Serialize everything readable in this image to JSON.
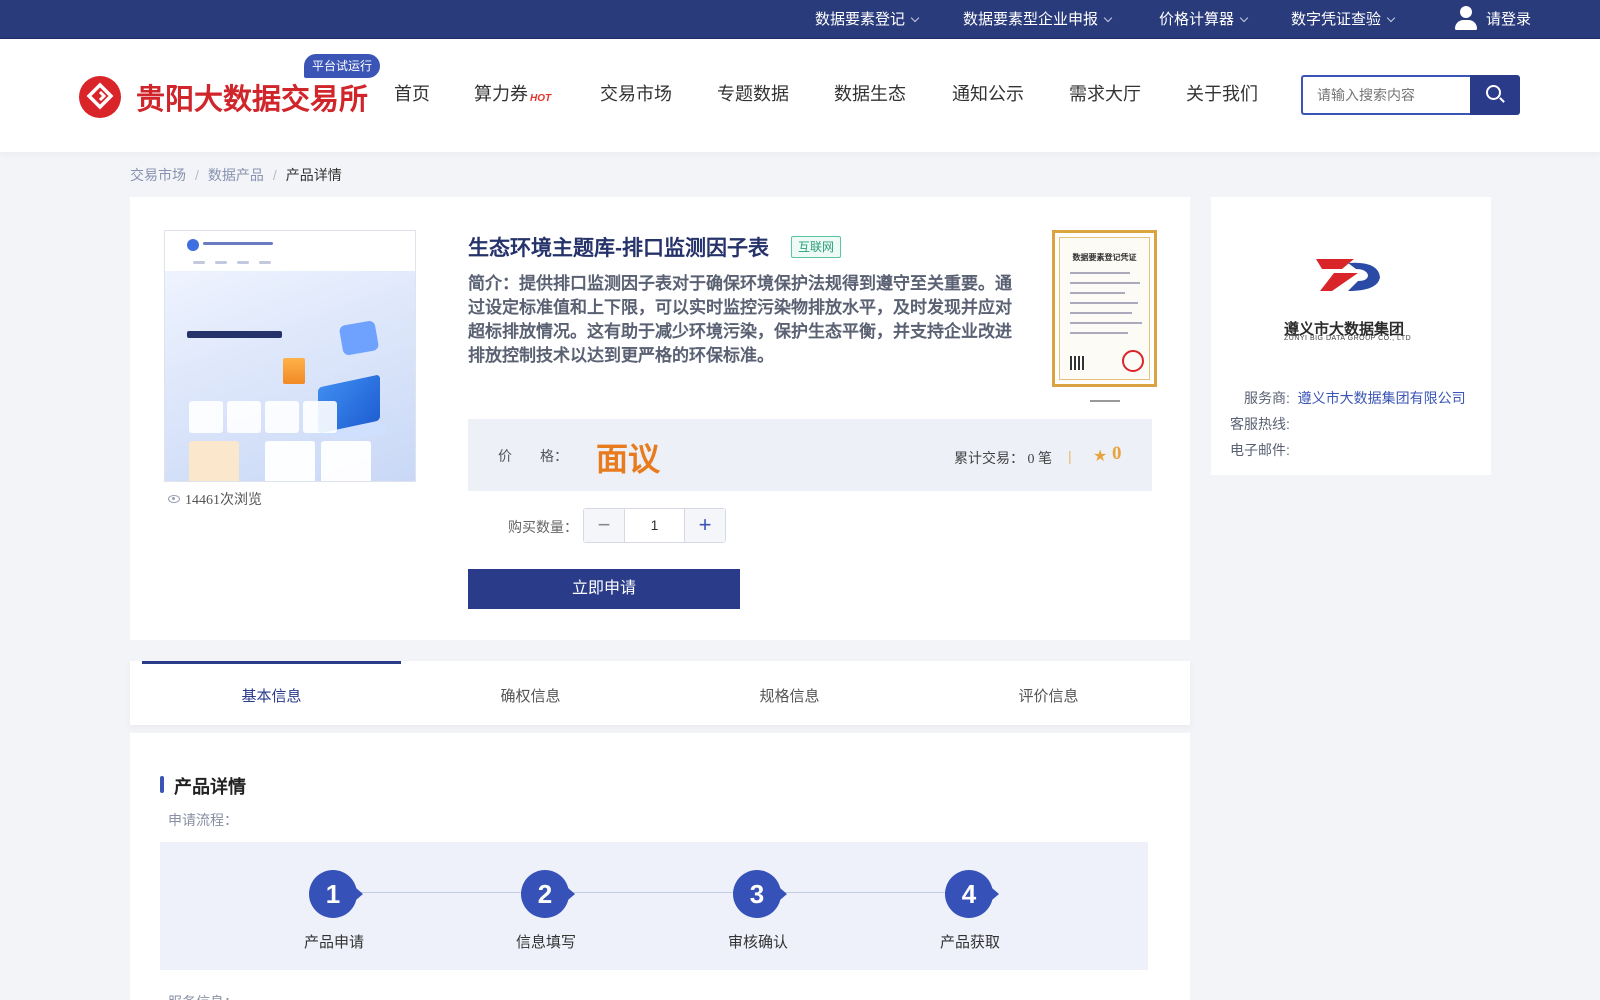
{
  "topbar": {
    "items": [
      {
        "label": "数据要素登记"
      },
      {
        "label": "数据要素型企业申报"
      },
      {
        "label": "价格计算器"
      },
      {
        "label": "数字凭证查验"
      }
    ],
    "login_label": "请登录"
  },
  "header": {
    "brand": "贵阳大数据交易所",
    "trial_badge": "平台试运行",
    "nav": [
      {
        "label": "首页"
      },
      {
        "label": "算力券",
        "badge": "HOT"
      },
      {
        "label": "交易市场"
      },
      {
        "label": "专题数据"
      },
      {
        "label": "数据生态"
      },
      {
        "label": "通知公示"
      },
      {
        "label": "需求大厅"
      },
      {
        "label": "关于我们"
      }
    ],
    "search_placeholder": "请输入搜索内容"
  },
  "breadcrumb": [
    "交易市场",
    "数据产品",
    "产品详情"
  ],
  "product": {
    "title": "生态环境主题库-排口监测因子表",
    "tag": "互联网",
    "description": "简介：提供排口监测因子表对于确保环境保护法规得到遵守至关重要。通过设定标准值和上下限，可以实时监控污染物排放水平，及时发现并应对超标排放情况。这有助于减少环境污染，保护生态平衡，并支持企业改进排放控制技术以达到更严格的环保标准。",
    "views": "14461次浏览",
    "certificate_title": "数据要素登记凭证",
    "price_label": "价　　格：",
    "price_value": "面议",
    "trades": "累计交易：  0 笔",
    "divider": "|",
    "rating": "0",
    "quantity_label": "购买数量：",
    "quantity": "1",
    "apply_label": "立即申请"
  },
  "provider": {
    "logo_name": "遵义市大数据集团",
    "logo_en": "ZUNYI BIG DATA GROUP CO., LTD",
    "service_label": "服务商:",
    "service_value": "遵义市大数据集团有限公司",
    "hotline_label": "客服热线:",
    "email_label": "电子邮件:"
  },
  "tabs": [
    {
      "label": "基本信息",
      "active": true
    },
    {
      "label": "确权信息"
    },
    {
      "label": "规格信息"
    },
    {
      "label": "评价信息"
    }
  ],
  "detail": {
    "section_title": "产品详情",
    "flow_label": "申请流程：",
    "steps": [
      {
        "num": "1",
        "label": "产品申请"
      },
      {
        "num": "2",
        "label": "信息填写"
      },
      {
        "num": "3",
        "label": "审核确认"
      },
      {
        "num": "4",
        "label": "产品获取"
      }
    ],
    "service_info_label": "服务信息："
  },
  "colors": {
    "primary": "#2a3b8a",
    "brand_red": "#d0262b",
    "price_orange": "#e87b1e",
    "tag_green": "#2aa079"
  }
}
